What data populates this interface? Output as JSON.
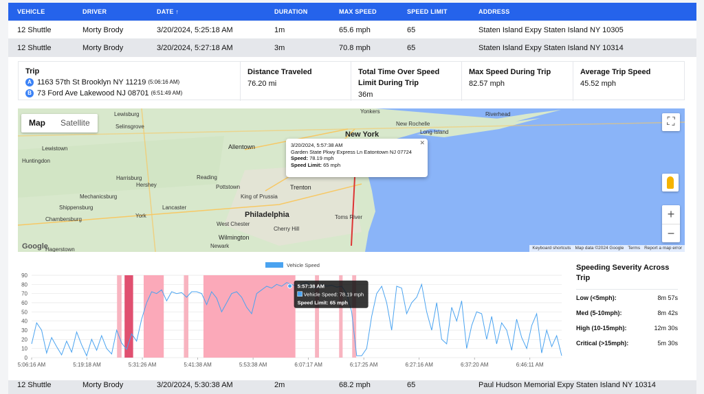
{
  "table": {
    "headers": [
      "VEHICLE",
      "DRIVER",
      "DATE ↑",
      "DURATION",
      "MAX SPEED",
      "SPEED LIMIT",
      "ADDRESS"
    ],
    "rows": [
      [
        "12 Shuttle",
        "Morty Brody",
        "3/20/2024, 5:25:18 AM",
        "1m",
        "65.6 mph",
        "65",
        "Staten Island Expy Staten Island NY 10305"
      ],
      [
        "12 Shuttle",
        "Morty Brody",
        "3/20/2024, 5:27:18 AM",
        "3m",
        "70.8 mph",
        "65",
        "Staten Island Expy Staten Island NY 10314"
      ],
      [
        "12 Shuttle",
        "Morty Brody",
        "3/20/2024, 5:30:38 AM",
        "2m",
        "68.2 mph",
        "65",
        "Paul Hudson Memorial Expy Staten Island NY 10314"
      ]
    ]
  },
  "trip": {
    "label": "Trip",
    "start_marker": "A",
    "start_address": "1163 57th St Brooklyn NY 11219",
    "start_time": "(5:06:16 AM)",
    "end_marker": "B",
    "end_address": "73 Ford Ave Lakewood NJ 08701",
    "end_time": "(6:51:49 AM)"
  },
  "stats": {
    "distance_label": "Distance Traveled",
    "distance_value": "76.20 mi",
    "over_label": "Total Time Over Speed Limit During Trip",
    "over_value": "36m",
    "max_label": "Max Speed During Trip",
    "max_value": "82.57 mph",
    "avg_label": "Average Trip Speed",
    "avg_value": "45.52 mph"
  },
  "map": {
    "tab_map": "Map",
    "tab_satellite": "Satellite",
    "places": {
      "yonkers": "Yonkers",
      "new_rochelle": "New Rochelle",
      "riverhead": "Riverhead",
      "long_island": "Long Island",
      "new_york": "New York",
      "allentown": "Allentown",
      "trenton": "Trenton",
      "philadelphia": "Philadelphia",
      "wilmington": "Wilmington",
      "toms_river": "Toms River",
      "harrisburg": "Harrisburg",
      "hershey": "Hershey",
      "reading": "Reading",
      "pottstown": "Pottstown",
      "lancaster": "Lancaster",
      "york": "York",
      "west_chester": "West Chester",
      "cherry_hill": "Cherry Hill",
      "king_of_prussia": "King of Prussia",
      "newark": "Newark",
      "lewistown": "Lewistown",
      "huntingdon": "Huntingdon",
      "mechanicsburg": "Mechanicsburg",
      "shippensburg": "Shippensburg",
      "chambersburg": "Chambersburg",
      "hagerstown": "Hagerstown",
      "selinsgrove": "Selinsgrove",
      "lewisburg": "Lewisburg"
    },
    "info_time": "3/20/2024, 5:57:38 AM",
    "info_address": "Garden State Pkwy Express Ln Eatontown NJ 07724",
    "info_speed_label": "Speed:",
    "info_speed": "78.19 mph",
    "info_limit_label": "Speed Limit:",
    "info_limit": "65 mph",
    "attribution": [
      "Keyboard shortcuts",
      "Map data ©2024 Google",
      "Terms",
      "Report a map error"
    ],
    "logo": "Google",
    "zoom_in": "+",
    "zoom_out": "−",
    "colors": {
      "land": "#d8e8cc",
      "water": "#8ab4f8",
      "urban": "#e8e2d9",
      "highway": "#f7c864"
    }
  },
  "chart_data": {
    "type": "line",
    "legend": "Vehicle Speed",
    "series_color": "#4aa3f0",
    "ylim": [
      0,
      90
    ],
    "yticks": [
      0,
      10,
      20,
      30,
      40,
      50,
      60,
      70,
      80,
      90
    ],
    "x_labels": [
      "5:06:16 AM",
      "5:19:18 AM",
      "5:31:26 AM",
      "5:41:38 AM",
      "5:53:38 AM",
      "6:07:17 AM",
      "6:17:25 AM",
      "6:27:16 AM",
      "6:37:20 AM",
      "6:46:11 AM"
    ],
    "x_range_minutes": [
      0,
      105.5
    ],
    "values": [
      15,
      38,
      30,
      5,
      22,
      12,
      3,
      18,
      6,
      28,
      14,
      2,
      20,
      8,
      24,
      10,
      4,
      30,
      16,
      9,
      26,
      18,
      42,
      60,
      72,
      70,
      74,
      62,
      72,
      70,
      71,
      66,
      72,
      72,
      70,
      58,
      72,
      65,
      50,
      60,
      70,
      72,
      66,
      55,
      48,
      70,
      74,
      78,
      76,
      80,
      78,
      82,
      80,
      78,
      80,
      82,
      78,
      76,
      80,
      78,
      79,
      77,
      78,
      70,
      50,
      2,
      2,
      10,
      45,
      70,
      78,
      60,
      30,
      78,
      76,
      48,
      60,
      66,
      80,
      50,
      30,
      60,
      20,
      15,
      55,
      40,
      62,
      10,
      35,
      50,
      48,
      20,
      45,
      15,
      38,
      30,
      8,
      42,
      22,
      10,
      35,
      48,
      5,
      30,
      12,
      24,
      2
    ],
    "speeding_bands": [
      {
        "start": 17.0,
        "end": 17.9,
        "severity": "medium"
      },
      {
        "start": 18.5,
        "end": 20.2,
        "severity": "critical"
      },
      {
        "start": 22.3,
        "end": 26.3,
        "severity": "high"
      },
      {
        "start": 30.3,
        "end": 31.2,
        "severity": "medium"
      },
      {
        "start": 34.2,
        "end": 52.5,
        "severity": "high"
      },
      {
        "start": 56.4,
        "end": 57.2,
        "severity": "medium"
      },
      {
        "start": 61.2,
        "end": 61.9,
        "severity": "medium"
      },
      {
        "start": 63.8,
        "end": 64.6,
        "severity": "medium"
      }
    ],
    "band_colors": {
      "medium": "#f8b4c0",
      "high": "#fba9b9",
      "critical": "#e05070"
    },
    "tooltip": {
      "time": "5:57:38 AM",
      "series": "Vehicle Speed: 78.19 mph",
      "limit": "Speed Limit: 65 mph",
      "x_minutes": 51.4,
      "y_value": 78.19
    }
  },
  "severity": {
    "title": "Speeding Severity Across Trip",
    "rows": [
      {
        "label": "Low (<5mph):",
        "value": "8m 57s"
      },
      {
        "label": "Med (5-10mph):",
        "value": "8m 42s"
      },
      {
        "label": "High (10-15mph):",
        "value": "12m 30s"
      },
      {
        "label": "Critical (>15mph):",
        "value": "5m 30s"
      }
    ]
  }
}
